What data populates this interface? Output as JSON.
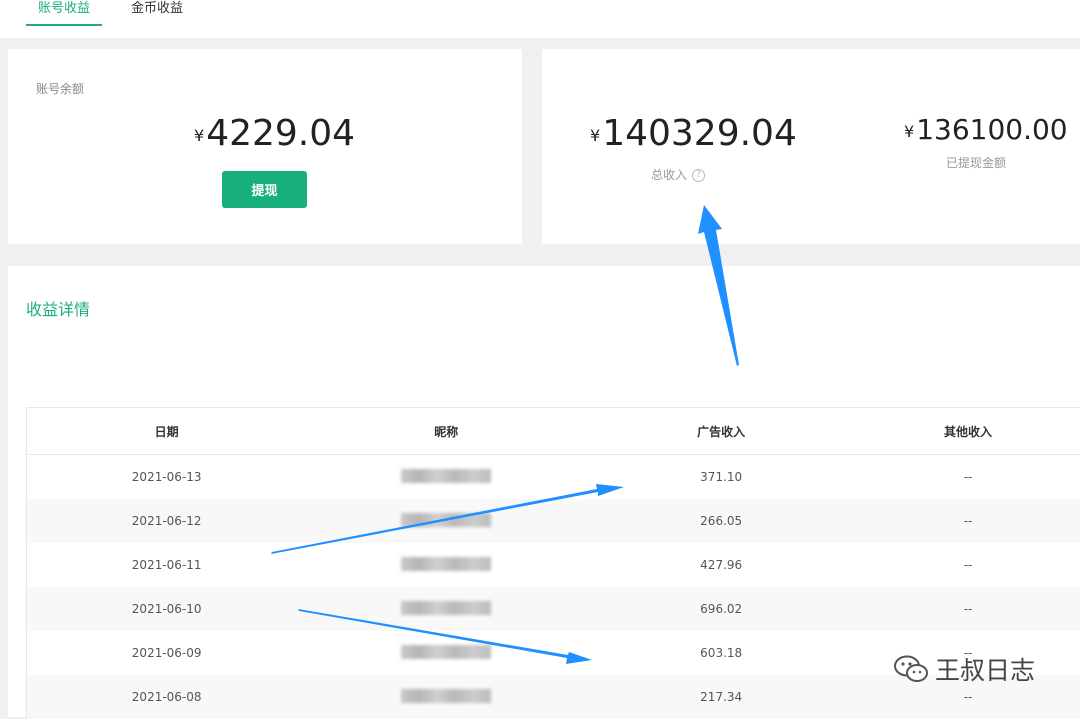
{
  "tabs": [
    {
      "label": "账号收益",
      "active": true
    },
    {
      "label": "金币收益",
      "active": false
    }
  ],
  "balance_card": {
    "label": "账号余额",
    "currency": "¥",
    "amount": "4229.04",
    "button_label": "提现"
  },
  "income_card": {
    "currency": "¥",
    "total_amount": "140329.04",
    "total_label": "总收入",
    "help_icon": "?",
    "withdrawn_amount": "136100.00",
    "withdrawn_label": "已提现金额"
  },
  "details": {
    "title": "收益详情",
    "columns": [
      "日期",
      "昵称",
      "广告收入",
      "其他收入"
    ],
    "rows": [
      {
        "date": "2021-06-13",
        "ad_income": "371.10",
        "other_income": "--"
      },
      {
        "date": "2021-06-12",
        "ad_income": "266.05",
        "other_income": "--"
      },
      {
        "date": "2021-06-11",
        "ad_income": "427.96",
        "other_income": "--"
      },
      {
        "date": "2021-06-10",
        "ad_income": "696.02",
        "other_income": "--"
      },
      {
        "date": "2021-06-09",
        "ad_income": "603.18",
        "other_income": "--"
      },
      {
        "date": "2021-06-08",
        "ad_income": "217.34",
        "other_income": "--"
      }
    ]
  },
  "watermark": {
    "text": "王叔日志"
  },
  "colors": {
    "accent": "#1aad80",
    "button": "#17b07a",
    "arrow": "#1e90ff"
  }
}
